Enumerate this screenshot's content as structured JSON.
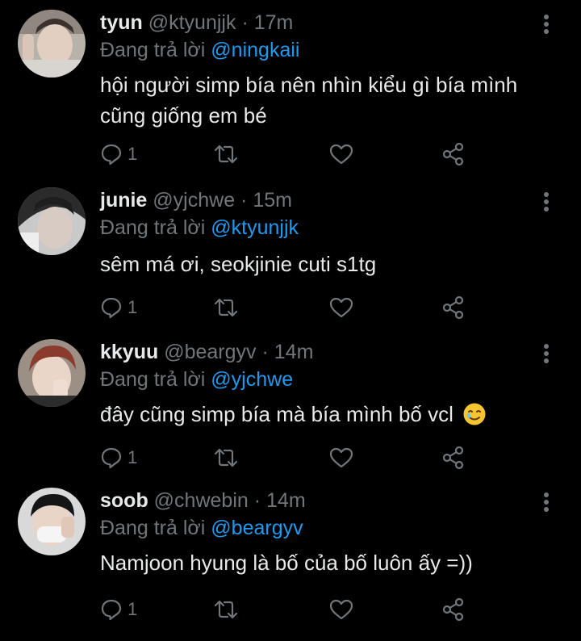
{
  "replies": [
    {
      "name": "tyun",
      "handle": "@ktyunjjk",
      "time": "17m",
      "reply_prefix": "Đang trả lời",
      "reply_to": "@ningkaii",
      "text": "hội người simp bía nên nhìn kiểu gì bía mình cũng giống em bé",
      "reply_count": "1"
    },
    {
      "name": "junie",
      "handle": "@yjchwe",
      "time": "15m",
      "reply_prefix": "Đang trả lời",
      "reply_to": "@ktyunjjk",
      "text": "sêm má ơi, seokjinie cuti s1tg",
      "reply_count": "1"
    },
    {
      "name": "kkyuu",
      "handle": "@beargyv",
      "time": "14m",
      "reply_prefix": "Đang trả lời",
      "reply_to": "@yjchwe",
      "text": "đây cũng simp bía mà bía mình bố vcl",
      "reply_count": "1"
    },
    {
      "name": "soob",
      "handle": "@chwebin",
      "time": "14m",
      "reply_prefix": "Đang trả lời",
      "reply_to": "@beargyv",
      "text": "Namjoon hyung là bố của bố luôn ấy =))",
      "reply_count": "1"
    }
  ],
  "separator": "·",
  "icons": {
    "reply": "comment-icon",
    "retweet": "retweet-icon",
    "like": "heart-icon",
    "share": "share-icon",
    "more": "more-vertical-icon",
    "emoji": "smiling-face-with-tear-emoji"
  },
  "colors": {
    "background": "#000000",
    "text": "#e7e9ea",
    "muted": "#71767b",
    "mention": "#1d9bf0"
  }
}
